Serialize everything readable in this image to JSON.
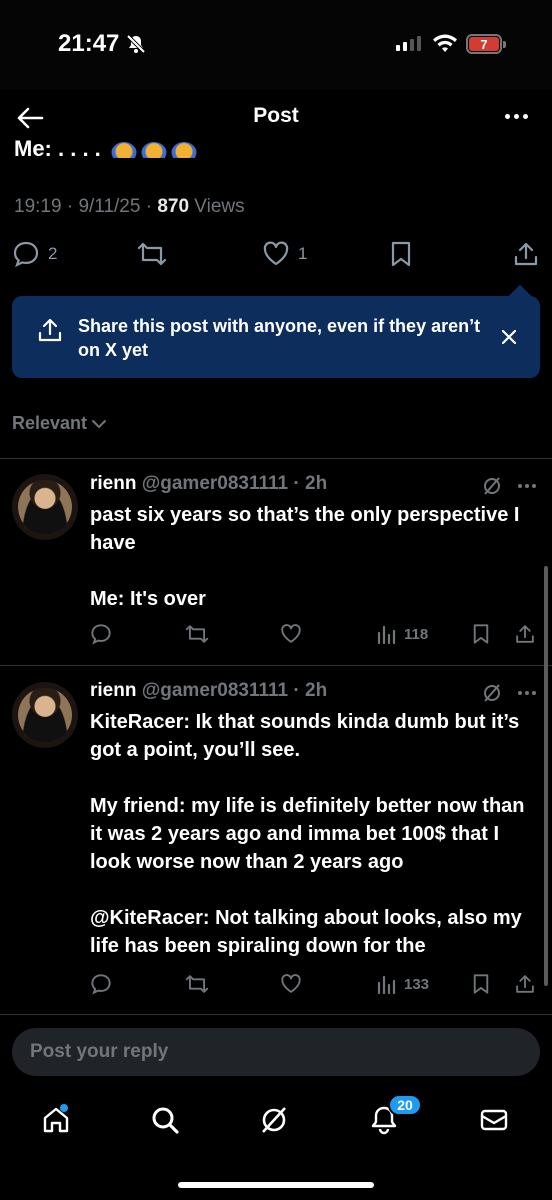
{
  "status_bar": {
    "time": "21:47",
    "battery": "7"
  },
  "header": {
    "title": "Post"
  },
  "post": {
    "clipped_text": "Me: . . . . ",
    "time": "19:19",
    "date": "9/11/25",
    "views_count": "870",
    "views_label": "Views",
    "replies": "2",
    "reposts": "",
    "likes": "1"
  },
  "share_banner": {
    "text": "Share this post with anyone, even if they aren’t on X yet"
  },
  "sort": {
    "label": "Relevant"
  },
  "replies": [
    {
      "name": "rienn",
      "handle": "@gamer0831111",
      "time": "2h",
      "paragraphs": [
        "past six years so that’s the only perspective I have",
        "Me: It's over"
      ],
      "views": "118"
    },
    {
      "name": "rienn",
      "handle": "@gamer0831111",
      "time": "2h",
      "paragraphs": [
        "KiteRacer: Ik that sounds kinda dumb but it’s got a point, you’ll see.",
        "My friend: my life is definitely better now than it was 2 years ago and imma bet 100$ that I look worse now than 2 years ago",
        "@KiteRacer: Not talking about looks, also my life has been spiraling down for the"
      ],
      "views": "133"
    }
  ],
  "compose": {
    "placeholder": "Post your reply"
  },
  "tabbar": {
    "notifications_count": "20"
  },
  "colors": {
    "accent": "#1d9bf0",
    "banner": "#0d2e5c",
    "muted": "#71767b"
  }
}
